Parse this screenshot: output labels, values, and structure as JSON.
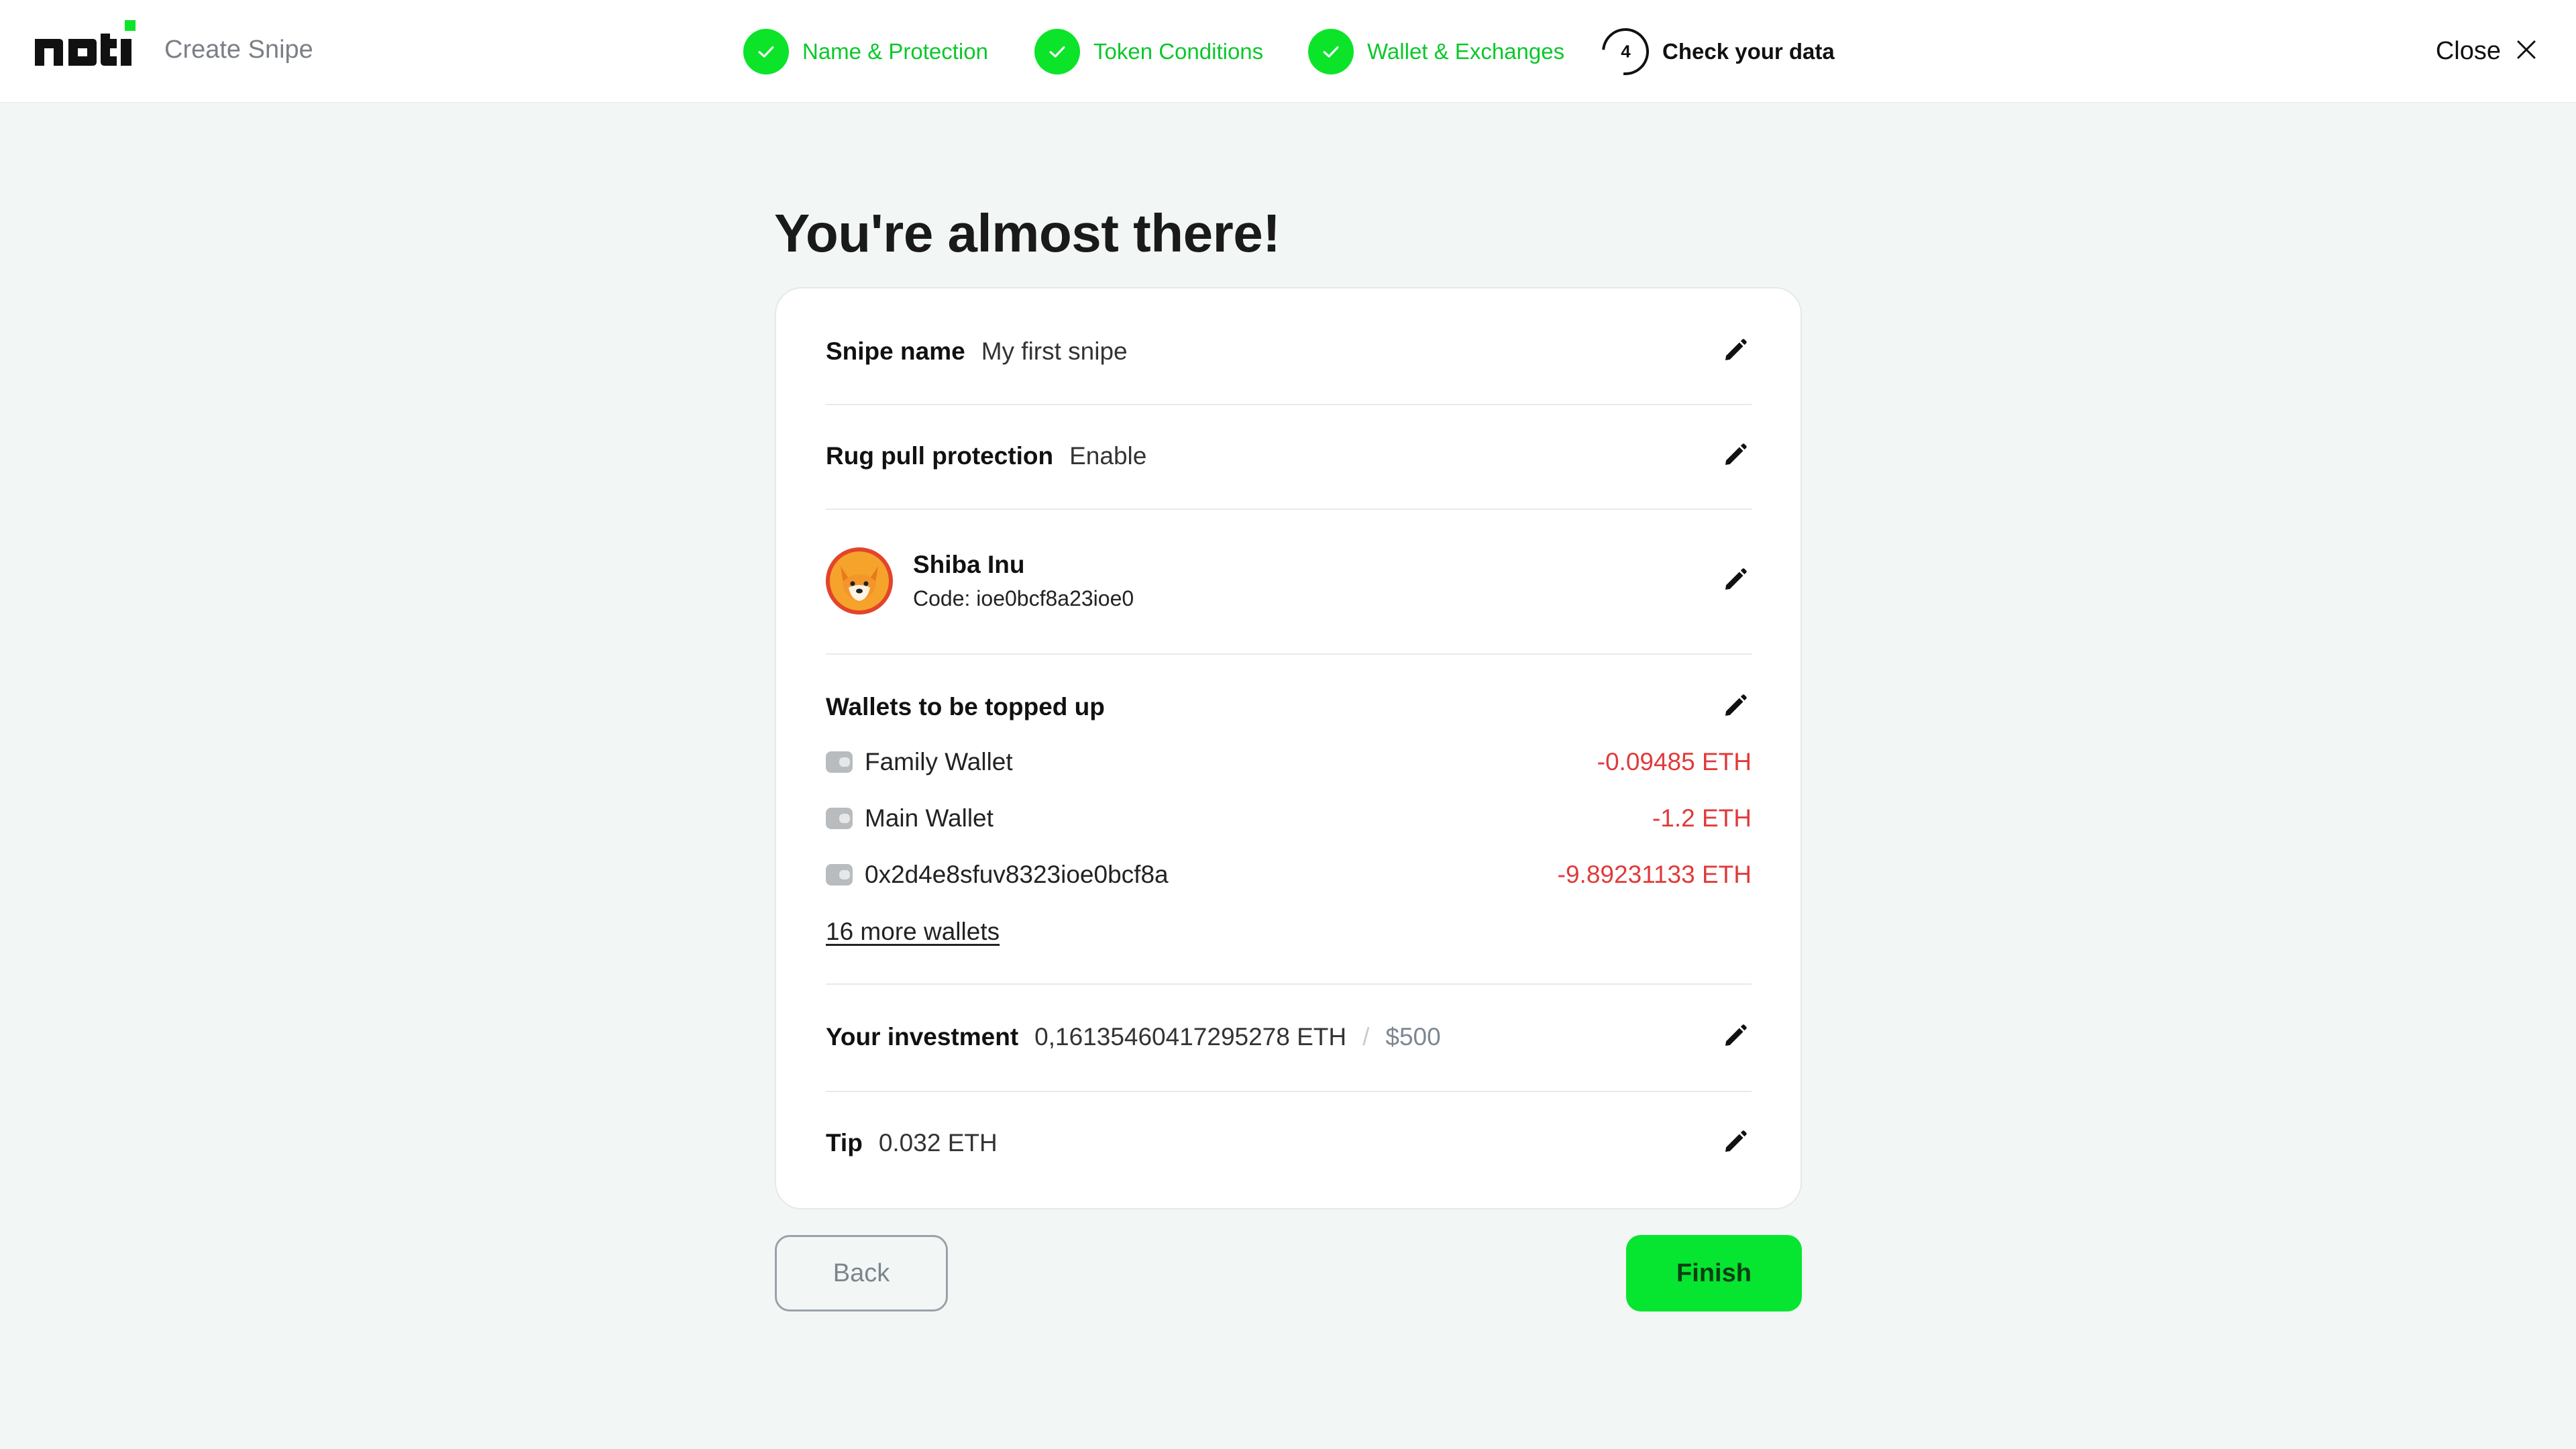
{
  "header": {
    "logo_text": "nbti",
    "app_title": "Create Snipe",
    "steps": [
      {
        "label": "Name & Protection",
        "status": "done"
      },
      {
        "label": "Token Conditions",
        "status": "done"
      },
      {
        "label": "Wallet & Exchanges",
        "status": "done"
      },
      {
        "label": "Check your data",
        "status": "active",
        "number": "4"
      }
    ],
    "close_label": "Close"
  },
  "main": {
    "title": "You're almost there!",
    "snipe_name": {
      "label": "Snipe name",
      "value": "My first snipe"
    },
    "rug_pull": {
      "label": "Rug pull protection",
      "value": "Enable"
    },
    "token": {
      "name": "Shiba Inu",
      "code": "Code: ioe0bcf8a23ioe0",
      "icon": "shiba-inu-logo"
    },
    "wallets": {
      "title": "Wallets to be topped up",
      "items": [
        {
          "name": "Family Wallet",
          "amount": "-0.09485 ETH"
        },
        {
          "name": "Main Wallet",
          "amount": "-1.2 ETH"
        },
        {
          "name": "0x2d4e8sfuv8323ioe0bcf8a",
          "amount": "-9.89231133 ETH"
        }
      ],
      "more_link": "16 more wallets"
    },
    "investment": {
      "label": "Your investment",
      "value": "0,16135460417295278 ETH",
      "separator": "/",
      "usd": "$500"
    },
    "tip": {
      "label": "Tip",
      "value": "0.032 ETH"
    }
  },
  "actions": {
    "back_label": "Back",
    "finish_label": "Finish"
  },
  "colors": {
    "accent_green": "#06e52f",
    "done_step_text": "#0bc72a",
    "negative_amount": "#e03a3a",
    "page_background": "#f2f7f6"
  }
}
